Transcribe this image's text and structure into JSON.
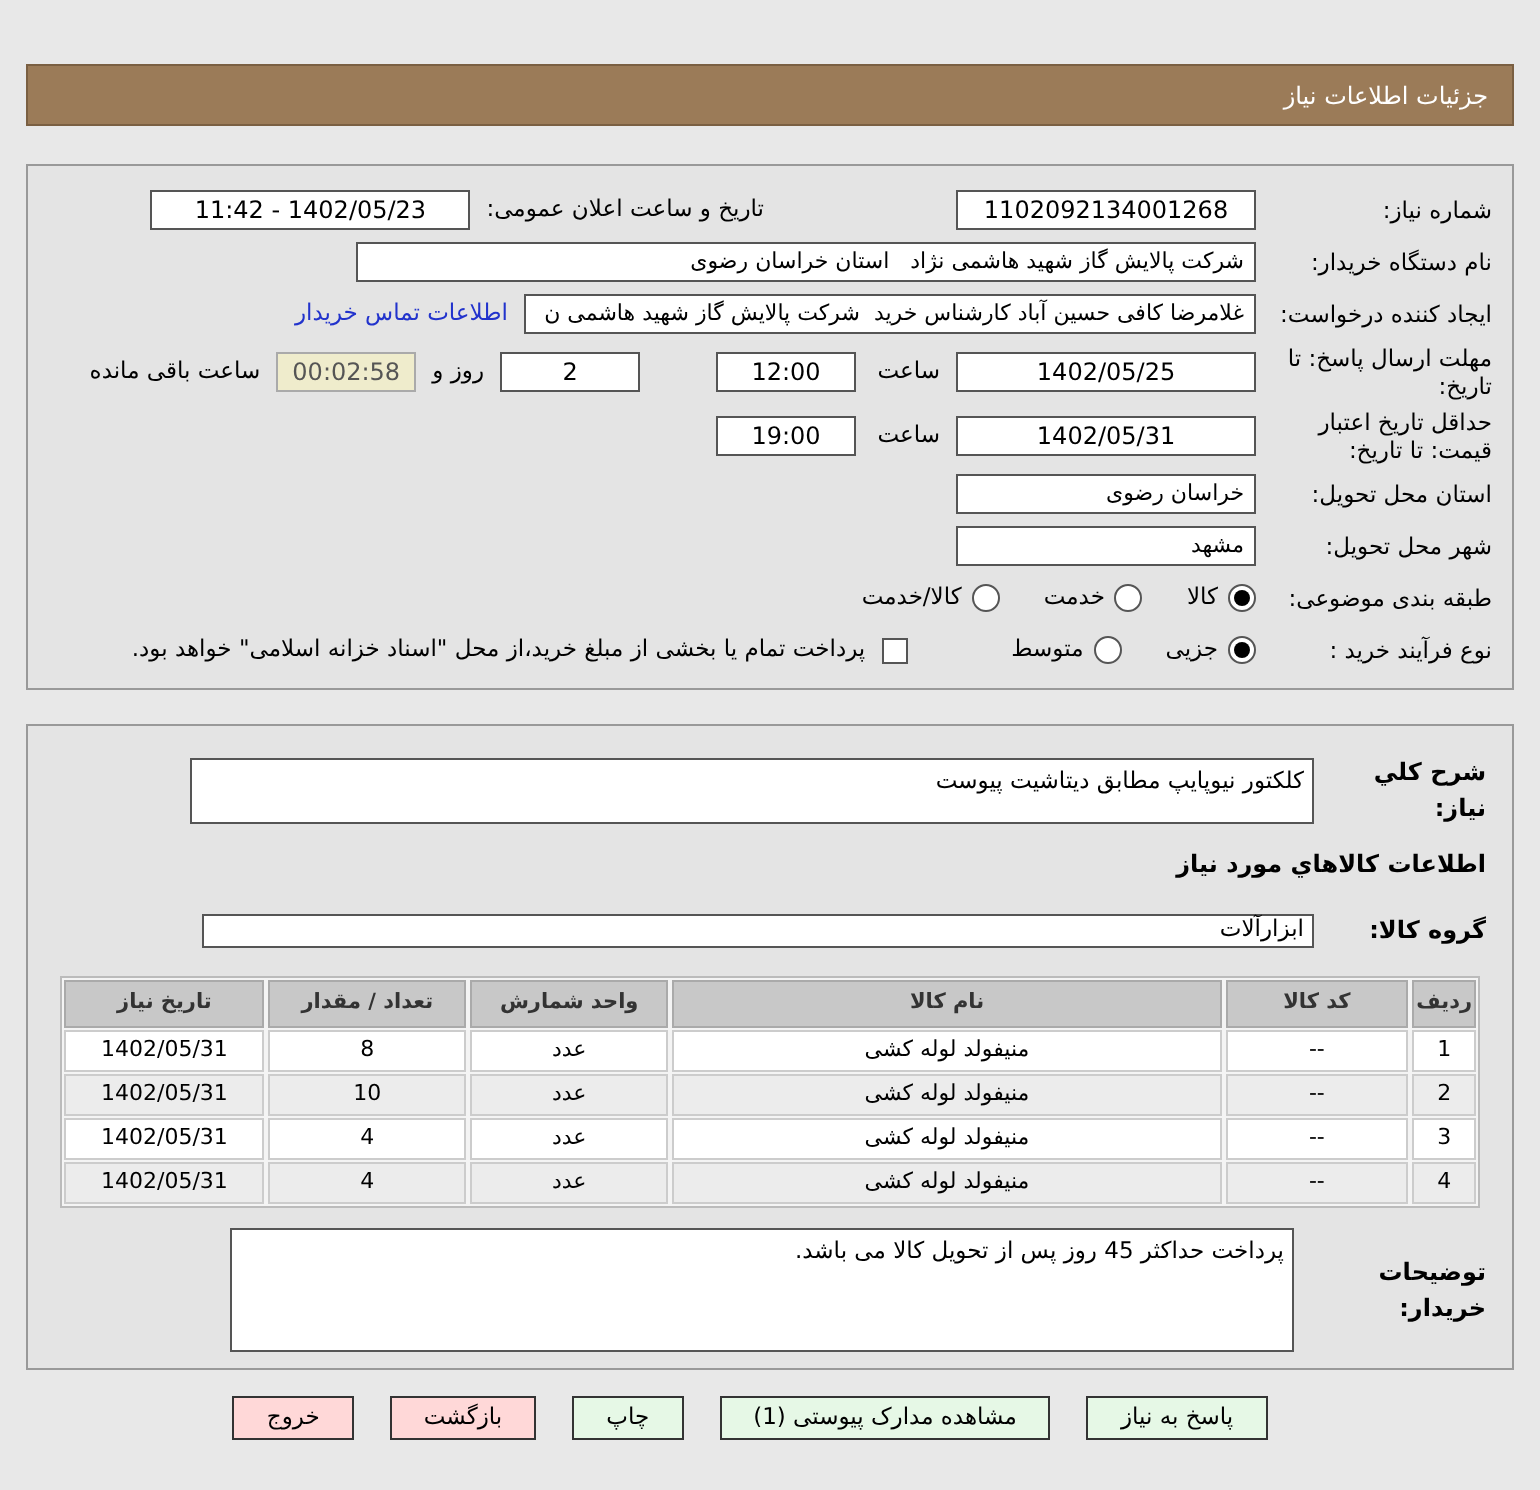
{
  "title": "جزئیات اطلاعات نیاز",
  "need_number": {
    "label": "شماره نیاز:",
    "value": "1102092134001268"
  },
  "announce": {
    "label": "تاریخ و ساعت اعلان عمومی:",
    "value": "1402/05/23 - 11:42"
  },
  "buyer": {
    "label": "نام دستگاه خریدار:",
    "value": "شرکت پالایش گاز شهید هاشمی نژاد   استان خراسان رضوی"
  },
  "requester": {
    "label": "ایجاد کننده درخواست:",
    "value": "غلامرضا کافی حسین آباد کارشناس خرید  شرکت پالایش گاز شهید هاشمی ن",
    "link": "اطلاعات تماس خریدار"
  },
  "deadline": {
    "label": "مهلت ارسال پاسخ: تا تاریخ:",
    "date": "1402/05/25",
    "time_label": "ساعت",
    "time": "12:00",
    "days": "2",
    "days_label": "روز و",
    "remaining": "00:02:58",
    "remaining_label": "ساعت باقی مانده"
  },
  "validity": {
    "label": "حداقل تاریخ اعتبار قیمت: تا تاریخ:",
    "date": "1402/05/31",
    "time_label": "ساعت",
    "time": "19:00"
  },
  "province": {
    "label": "استان محل تحویل:",
    "value": "خراسان رضوی"
  },
  "city": {
    "label": "شهر محل تحویل:",
    "value": "مشهد"
  },
  "category": {
    "label": "طبقه بندی موضوعی:",
    "options": [
      {
        "label": "کالا",
        "selected": true
      },
      {
        "label": "خدمت",
        "selected": false
      },
      {
        "label": "کالا/خدمت",
        "selected": false
      }
    ]
  },
  "process": {
    "label": "نوع فرآیند خرید :",
    "options": [
      {
        "label": "جزیی",
        "selected": true
      },
      {
        "label": "متوسط",
        "selected": false
      }
    ],
    "payment": {
      "label": "پرداخت تمام یا بخشی از مبلغ خرید،از محل \"اسناد خزانه اسلامی\" خواهد بود.",
      "checked": false
    }
  },
  "description": {
    "label": "شرح کلي نياز:",
    "value": "کلکتور نیوپایپ مطابق دیتاشیت پیوست"
  },
  "goods_heading": "اطلاعات کالاهاي مورد نياز",
  "group": {
    "label": "گروه کالا:",
    "value": "ابزارآلات"
  },
  "table": {
    "columns": [
      "ردیف",
      "کد کالا",
      "نام کالا",
      "واحد شمارش",
      "تعداد / مقدار",
      "تاریخ نیاز"
    ],
    "rows": [
      [
        "1",
        "--",
        "منیفولد لوله کشی",
        "عدد",
        "8",
        "1402/05/31"
      ],
      [
        "2",
        "--",
        "منیفولد لوله کشی",
        "عدد",
        "10",
        "1402/05/31"
      ],
      [
        "3",
        "--",
        "منیفولد لوله کشی",
        "عدد",
        "4",
        "1402/05/31"
      ],
      [
        "4",
        "--",
        "منیفولد لوله کشی",
        "عدد",
        "4",
        "1402/05/31"
      ]
    ]
  },
  "notes": {
    "label": "توضیحات خریدار:",
    "value": "پرداخت حداکثر 45 روز پس از تحویل کالا می باشد."
  },
  "buttons": [
    {
      "label": "پاسخ به نیاز",
      "kind": "normal"
    },
    {
      "label": "مشاهده مدارک پیوستی (1)",
      "kind": "normal"
    },
    {
      "label": "چاپ",
      "kind": "normal"
    },
    {
      "label": "بازگشت",
      "kind": "danger"
    },
    {
      "label": "خروج",
      "kind": "danger"
    }
  ]
}
